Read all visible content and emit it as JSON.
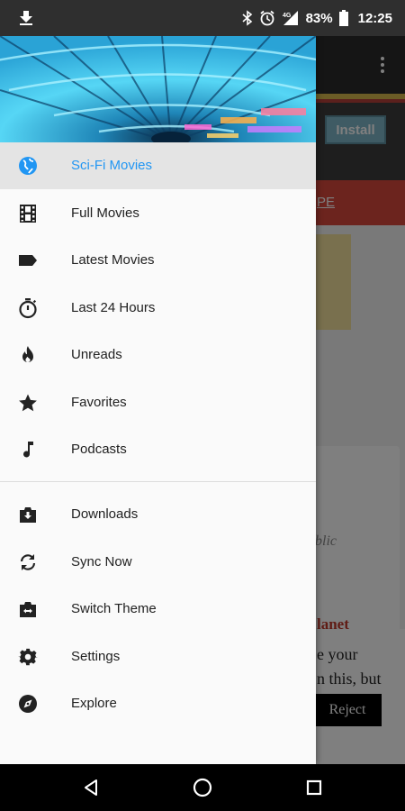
{
  "status_bar": {
    "battery": "83%",
    "time": "12:25",
    "icons": [
      "download-icon",
      "bluetooth-icon",
      "alarm-icon",
      "signal-4g-icon",
      "battery-icon"
    ]
  },
  "drawer": {
    "header_image": "tunnel-header-image",
    "primary_items": [
      {
        "label": "Sci-Fi Movies",
        "icon": "globe-icon",
        "active": true
      },
      {
        "label": "Full Movies",
        "icon": "film-icon"
      },
      {
        "label": "Latest Movies",
        "icon": "tag-icon"
      },
      {
        "label": "Last 24 Hours",
        "icon": "timer-icon"
      },
      {
        "label": "Unreads",
        "icon": "flame-icon"
      },
      {
        "label": "Favorites",
        "icon": "star-icon"
      },
      {
        "label": "Podcasts",
        "icon": "music-note-icon"
      }
    ],
    "secondary_items": [
      {
        "label": "Downloads",
        "icon": "downloads-icon"
      },
      {
        "label": "Sync Now",
        "icon": "sync-icon"
      },
      {
        "label": "Switch Theme",
        "icon": "switch-theme-icon"
      },
      {
        "label": "Settings",
        "icon": "gear-icon"
      },
      {
        "label": "Explore",
        "icon": "compass-icon"
      }
    ],
    "active_color": "#2196f3"
  },
  "background_app": {
    "install_label": "Install",
    "banner_fragment": "PE",
    "italic_fragment": "blic",
    "title_fragment": "lanet",
    "consent_line1": "e your",
    "consent_line2": "n this, but",
    "reject_label": "Reject"
  },
  "nav_bar": {
    "buttons": [
      "back-icon",
      "home-icon",
      "recents-icon"
    ]
  }
}
